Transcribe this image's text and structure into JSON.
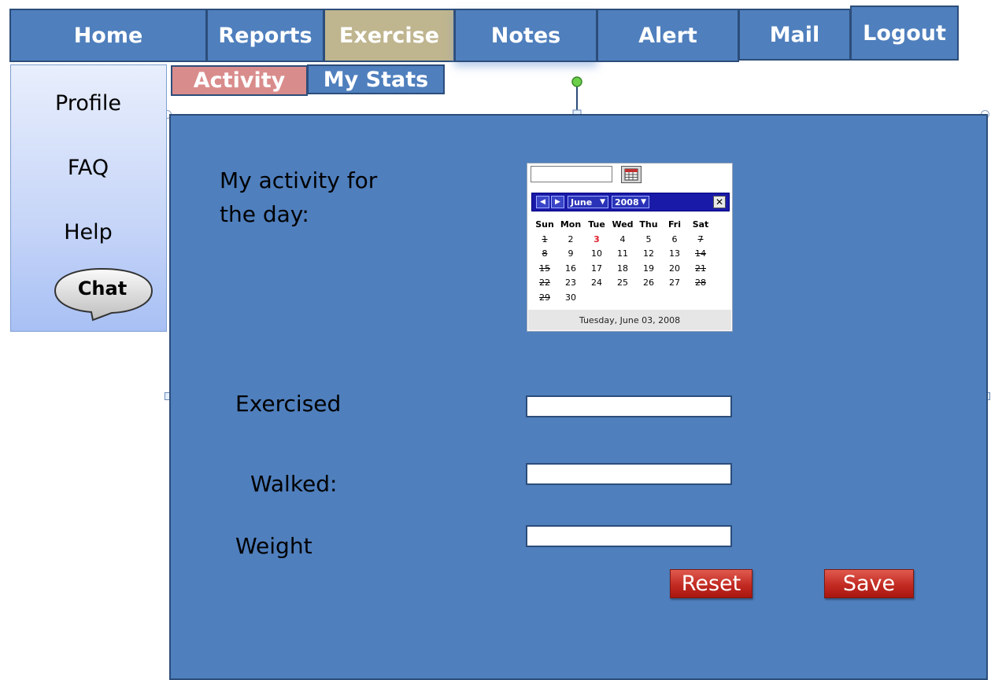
{
  "nav": {
    "tabs": [
      {
        "label": "Home"
      },
      {
        "label": "Reports"
      },
      {
        "label": "Exercise"
      },
      {
        "label": "Notes"
      },
      {
        "label": "Alert"
      },
      {
        "label": "Mail"
      },
      {
        "label": "Logout"
      }
    ],
    "active": "Exercise"
  },
  "subtabs": [
    {
      "label": "Activity"
    },
    {
      "label": "My Stats"
    }
  ],
  "sidebar": {
    "items": [
      {
        "label": "Profile"
      },
      {
        "label": "FAQ"
      },
      {
        "label": "Help"
      }
    ],
    "chat_label": "Chat"
  },
  "main": {
    "activity_label_line1": "My activity for",
    "activity_label_line2": "the day:",
    "fields": [
      {
        "label": "Exercised",
        "value": ""
      },
      {
        "label": "Walked:",
        "value": ""
      },
      {
        "label": "Weight",
        "value": ""
      }
    ],
    "reset_label": "Reset",
    "save_label": "Save"
  },
  "calendar": {
    "input_value": "",
    "month": "June",
    "year": "2008",
    "weekdays": [
      "Sun",
      "Mon",
      "Tue",
      "Wed",
      "Thu",
      "Fri",
      "Sat"
    ],
    "weeks": [
      [
        "1",
        "2",
        "3",
        "4",
        "5",
        "6",
        "7"
      ],
      [
        "8",
        "9",
        "10",
        "11",
        "12",
        "13",
        "14"
      ],
      [
        "15",
        "16",
        "17",
        "18",
        "19",
        "20",
        "21"
      ],
      [
        "22",
        "23",
        "24",
        "25",
        "26",
        "27",
        "28"
      ],
      [
        "29",
        "30",
        "",
        "",
        "",
        "",
        ""
      ]
    ],
    "today": "3",
    "footer": "Tuesday, June 03, 2008"
  },
  "colors": {
    "panel": "#4f7fbd",
    "active_tab": "#bfb58f",
    "activity_subtab": "#d98c8c",
    "button_red": "#c22b22",
    "calendar_header": "#1a1aa8"
  }
}
